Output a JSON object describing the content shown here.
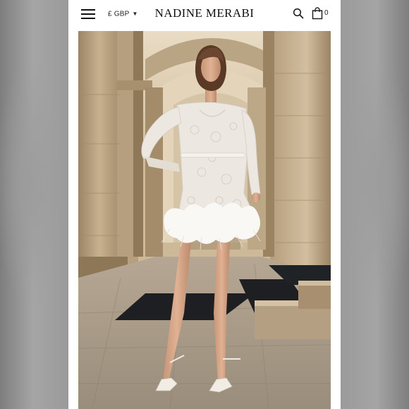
{
  "header": {
    "brand": "NADINE MERABI",
    "currency": "£ GBP",
    "cart_count": "0",
    "icons": {
      "menu": "hamburger-menu-icon",
      "currency": "chevron-down-icon",
      "search": "search-icon",
      "cart": "shopping-bag-icon"
    }
  },
  "product_image": {
    "description_icon": "product-photo"
  },
  "colors": {
    "header_bg": "#ffffff",
    "text": "#111111",
    "backdrop": "#9a9a9a"
  }
}
